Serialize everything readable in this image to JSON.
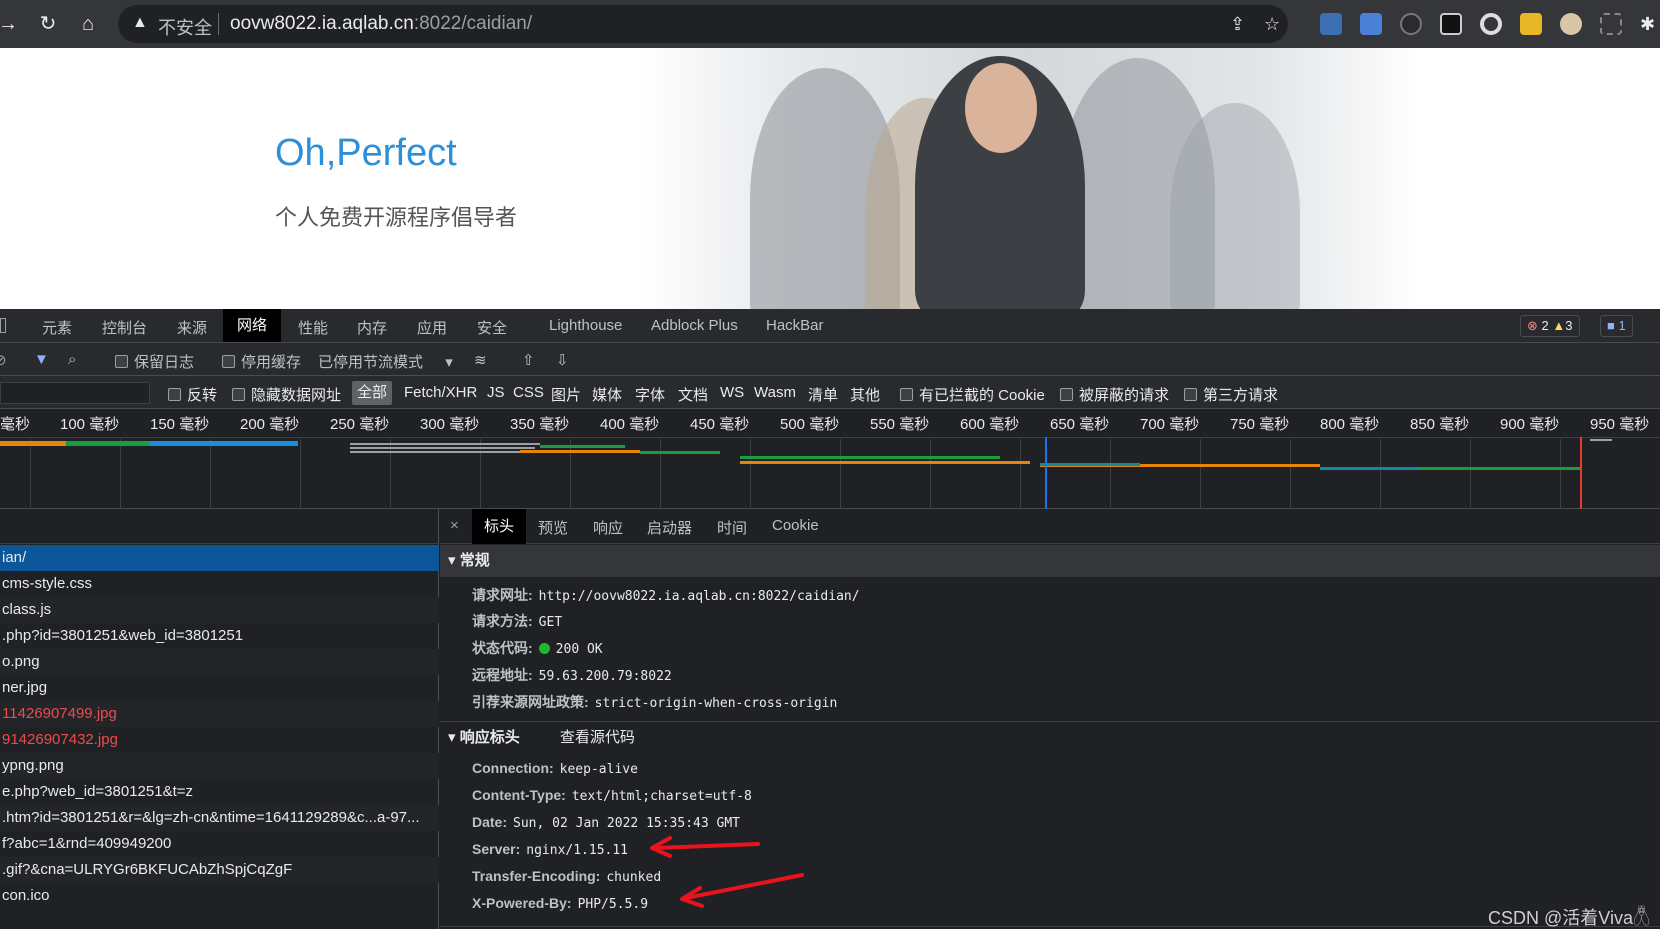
{
  "browser": {
    "insecure_label": "不安全",
    "url_host": "oovw8022.ia.aqlab.cn",
    "url_rest": ":8022/caidian/"
  },
  "page": {
    "hero_title": "Oh,Perfect",
    "hero_subtitle": "个人免费开源程序倡导者"
  },
  "devtools": {
    "tabs": [
      "元素",
      "控制台",
      "来源",
      "网络",
      "性能",
      "内存",
      "应用",
      "安全",
      "Lighthouse",
      "Adblock Plus",
      "HackBar"
    ],
    "active_tab": "网络",
    "errors": "2",
    "warnings": "3",
    "messages": "1",
    "toolbar": {
      "preserve_log": "保留日志",
      "disable_cache": "停用缓存",
      "throttle": "已停用节流模式"
    },
    "filter": {
      "invert": "反转",
      "hide_data_urls": "隐藏数据网址",
      "types": [
        "全部",
        "Fetch/XHR",
        "JS",
        "CSS",
        "图片",
        "媒体",
        "字体",
        "文档",
        "WS",
        "Wasm",
        "清单",
        "其他"
      ],
      "blocked_cookies": "有已拦截的 Cookie",
      "blocked_requests": "被屏蔽的请求",
      "third_party": "第三方请求"
    },
    "timeline_ticks": [
      "毫秒",
      "100 毫秒",
      "150 毫秒",
      "200 毫秒",
      "250 毫秒",
      "300 毫秒",
      "350 毫秒",
      "400 毫秒",
      "450 毫秒",
      "500 毫秒",
      "550 毫秒",
      "600 毫秒",
      "650 毫秒",
      "700 毫秒",
      "750 毫秒",
      "800 毫秒",
      "850 毫秒",
      "900 毫秒",
      "950 毫秒"
    ],
    "requests": [
      {
        "name": "ian/",
        "state": "selected"
      },
      {
        "name": "cms-style.css",
        "state": "normal"
      },
      {
        "name": "class.js",
        "state": "normal"
      },
      {
        "name": ".php?id=3801251&web_id=3801251",
        "state": "normal"
      },
      {
        "name": "o.png",
        "state": "normal"
      },
      {
        "name": "ner.jpg",
        "state": "normal"
      },
      {
        "name": "11426907499.jpg",
        "state": "error"
      },
      {
        "name": "91426907432.jpg",
        "state": "error"
      },
      {
        "name": "ypng.png",
        "state": "normal"
      },
      {
        "name": "e.php?web_id=3801251&t=z",
        "state": "normal"
      },
      {
        "name": ".htm?id=3801251&r=&lg=zh-cn&ntime=1641129289&c...a-97...",
        "state": "normal"
      },
      {
        "name": "f?abc=1&rnd=409949200",
        "state": "normal"
      },
      {
        "name": ".gif?&cna=ULRYGr6BKFUCAbZhSpjCqZgF",
        "state": "normal"
      },
      {
        "name": "con.ico",
        "state": "normal"
      }
    ],
    "detail_tabs": [
      "标头",
      "预览",
      "响应",
      "启动器",
      "时间",
      "Cookie"
    ],
    "general": {
      "title": "常规",
      "rows": [
        {
          "k": "请求网址:",
          "v": "http://oovw8022.ia.aqlab.cn:8022/caidian/"
        },
        {
          "k": "请求方法:",
          "v": "GET"
        },
        {
          "k": "状态代码:",
          "v": "200 OK"
        },
        {
          "k": "远程地址:",
          "v": "59.63.200.79:8022"
        },
        {
          "k": "引荐来源网址政策:",
          "v": "strict-origin-when-cross-origin"
        }
      ]
    },
    "response_headers": {
      "title": "响应标头",
      "view_source": "查看源代码",
      "rows": [
        {
          "k": "Connection:",
          "v": "keep-alive"
        },
        {
          "k": "Content-Type:",
          "v": "text/html;charset=utf-8"
        },
        {
          "k": "Date:",
          "v": "Sun, 02 Jan 2022 15:35:43 GMT"
        },
        {
          "k": "Server:",
          "v": "nginx/1.15.11"
        },
        {
          "k": "Transfer-Encoding:",
          "v": "chunked"
        },
        {
          "k": "X-Powered-By:",
          "v": "PHP/5.5.9"
        }
      ]
    }
  },
  "watermark": "CSDN @活着Viva𓆦",
  "colors": {
    "accent_blue": "#2d8fd8",
    "selected_row": "#0b5699",
    "error_text": "#ee4b4b",
    "annotation_red": "#e8141c"
  }
}
